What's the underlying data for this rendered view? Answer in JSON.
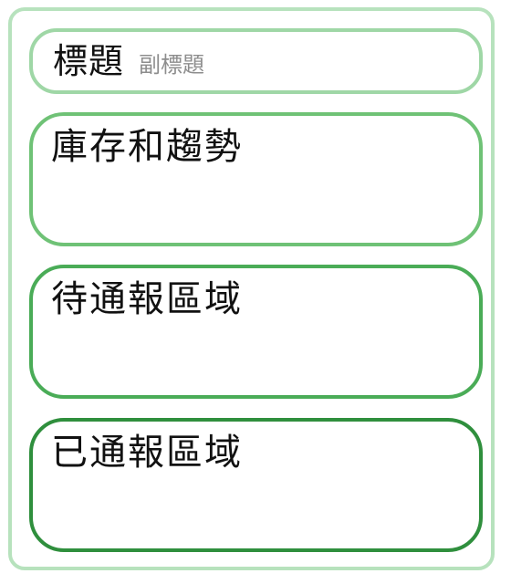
{
  "header": {
    "title": "標題",
    "subtitle": "副標題"
  },
  "panels": [
    {
      "label": "庫存和趨勢",
      "border_color": "#6fc276"
    },
    {
      "label": "待通報區域",
      "border_color": "#4aac57"
    },
    {
      "label": "已通報區域",
      "border_color": "#2f8f3d"
    }
  ],
  "colors": {
    "frame_border": "#b7e2bd",
    "header_border": "#9fd7a6"
  }
}
